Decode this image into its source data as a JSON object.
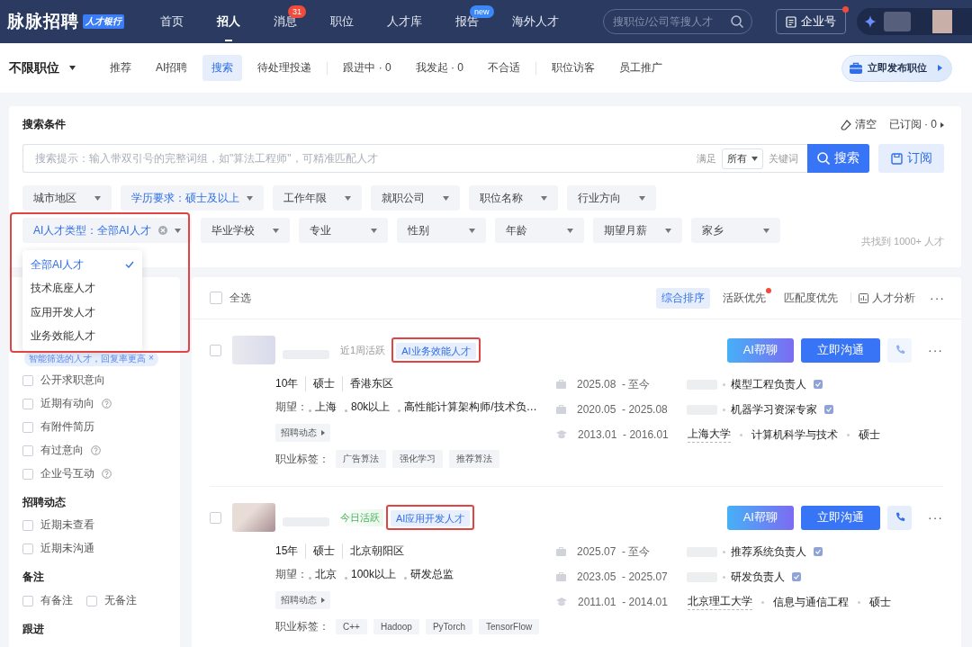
{
  "top_nav": {
    "logo": "脉脉招聘",
    "logo_badge": "人才银行",
    "items": [
      {
        "label": "首页",
        "selected": false
      },
      {
        "label": "招人",
        "selected": true
      },
      {
        "label": "消息",
        "selected": false,
        "badge": {
          "text": "31",
          "color": "#f04b3c"
        }
      },
      {
        "label": "职位",
        "selected": false
      },
      {
        "label": "人才库",
        "selected": false
      },
      {
        "label": "报告",
        "selected": false,
        "badge": {
          "text": "new",
          "color": "#3b87f7"
        }
      },
      {
        "label": "海外人才",
        "selected": false
      }
    ],
    "search": {
      "placeholder": "搜职位/公司等搜人才"
    },
    "enterprise_button": "企业号"
  },
  "sub_nav": {
    "position_filter": "不限职位",
    "tabs": [
      {
        "label": "推荐",
        "selected": false
      },
      {
        "label": "AI招聘",
        "selected": false
      },
      {
        "label": "搜索",
        "selected": true
      },
      {
        "label": "待处理投递",
        "selected": false
      },
      {
        "label": "跟进中 · 0",
        "selected": false
      },
      {
        "label": "我发起 · 0",
        "selected": false
      },
      {
        "label": "不合适",
        "selected": false
      },
      {
        "label": "职位访客",
        "selected": false
      },
      {
        "label": "员工推广",
        "selected": false
      }
    ],
    "publish_button": "立即发布职位"
  },
  "search_panel": {
    "title": "搜索条件",
    "clear": "清空",
    "subscribed": "已订阅 · 0",
    "query": {
      "placeholder": "搜索提示：输入带双引号的完整词组，如\"算法工程师\"，可精准匹配人才"
    },
    "match_label": "满足",
    "match_value": "所有",
    "keyword_label": "关键词",
    "search_button": "搜索",
    "subscribe_button": "订阅",
    "filters": [
      [
        {
          "label": "城市地区",
          "active": false
        },
        {
          "label": "学历要求：硕士及以上",
          "active": true
        },
        {
          "label": "工作年限",
          "active": false
        },
        {
          "label": "就职公司",
          "active": false
        },
        {
          "label": "职位名称",
          "active": false
        },
        {
          "label": "行业方向",
          "active": false
        }
      ],
      [
        {
          "label": "AI人才类型：全部AI人才",
          "active": true,
          "clearable": true,
          "open": true
        },
        {
          "label": "毕业学校",
          "active": false
        },
        {
          "label": "专业",
          "active": false
        },
        {
          "label": "性别",
          "active": false
        },
        {
          "label": "年龄",
          "active": false
        },
        {
          "label": "期望月薪",
          "active": false
        },
        {
          "label": "家乡",
          "active": false
        }
      ]
    ],
    "result_count": "共找到 1000+ 人才",
    "dropdown": {
      "highlighted": true,
      "options": [
        {
          "label": "全部AI人才",
          "selected": true
        },
        {
          "label": "技术底座人才",
          "selected": false
        },
        {
          "label": "应用开发人才",
          "selected": false
        },
        {
          "label": "业务效能人才",
          "selected": false
        }
      ]
    }
  },
  "sidebar": {
    "tag": "智能筛选的人才，回复率更高",
    "tag_close": "×",
    "sections": [
      {
        "options": [
          {
            "label": "公开求职意向",
            "checked": false,
            "help": false
          },
          {
            "label": "近期有动向",
            "checked": false,
            "help": true
          },
          {
            "label": "有附件简历",
            "checked": false,
            "help": false
          },
          {
            "label": "有过意向",
            "checked": false,
            "help": true
          },
          {
            "label": "企业号互动",
            "checked": false,
            "help": true
          }
        ]
      },
      {
        "title": "招聘动态",
        "options": [
          {
            "label": "近期未查看",
            "checked": false,
            "help": false
          },
          {
            "label": "近期未沟通",
            "checked": false,
            "help": false
          }
        ]
      },
      {
        "title": "备注",
        "inline": true,
        "options": [
          {
            "label": "有备注",
            "checked": false,
            "help": false
          },
          {
            "label": "无备注",
            "checked": false,
            "help": false
          }
        ]
      },
      {
        "title": "跟进"
      }
    ]
  },
  "results": {
    "select_all": {
      "label": "全选",
      "checked": false
    },
    "sort_options": [
      {
        "label": "综合排序",
        "selected": true,
        "dot": false
      },
      {
        "label": "活跃优先",
        "selected": false,
        "dot": true
      },
      {
        "label": "匹配度优先",
        "selected": false,
        "dot": false
      }
    ],
    "analysis": "人才分析",
    "more": "···",
    "candidates": [
      {
        "checked": false,
        "activity": "近1周活跃",
        "active_today": false,
        "tag": "AI业务效能人才",
        "tag_highlighted": true,
        "chat_ai": "AI帮聊",
        "chat": "立即沟通",
        "phone_enabled": false,
        "more": "···",
        "basics": [
          "10年",
          "硕士",
          "香港东区"
        ],
        "expect_label": "期望：",
        "expectations": [
          "上海",
          "80k以上",
          "高性能计算架构师/技术负…"
        ],
        "dynamics_button": "招聘动态",
        "tags_label": "职业标签：",
        "tags": [
          "广告算法",
          "强化学习",
          "推荐算法"
        ],
        "experience": [
          {
            "kind": "work",
            "period": "2025.08  - 至今",
            "items": [
              "模型工程负责人"
            ]
          },
          {
            "kind": "work",
            "period": "2020.05  - 2025.08",
            "items": [
              "机器学习资深专家"
            ]
          },
          {
            "kind": "education",
            "period": "2013.01  - 2016.01",
            "items": [
              "上海大学",
              "计算机科学与技术",
              "硕士"
            ]
          }
        ]
      },
      {
        "checked": false,
        "activity": "今日活跃",
        "active_today": true,
        "tag": "AI应用开发人才",
        "tag_highlighted": true,
        "chat_ai": "AI帮聊",
        "chat": "立即沟通",
        "phone_enabled": true,
        "more": "···",
        "basics": [
          "15年",
          "硕士",
          "北京朝阳区"
        ],
        "expect_label": "期望：",
        "expectations": [
          "北京",
          "100k以上",
          "研发总监"
        ],
        "dynamics_button": "招聘动态",
        "tags_label": "职业标签：",
        "tags": [
          "C++",
          "Hadoop",
          "PyTorch",
          "TensorFlow"
        ],
        "experience": [
          {
            "kind": "work",
            "period": "2025.07  - 至今",
            "items": [
              "推荐系统负责人"
            ]
          },
          {
            "kind": "work",
            "period": "2023.05  - 2025.07",
            "items": [
              "研发负责人"
            ]
          },
          {
            "kind": "education",
            "period": "2011.01  - 2014.01",
            "items": [
              "北京理工大学",
              "信息与通信工程",
              "硕士"
            ]
          }
        ]
      }
    ]
  }
}
